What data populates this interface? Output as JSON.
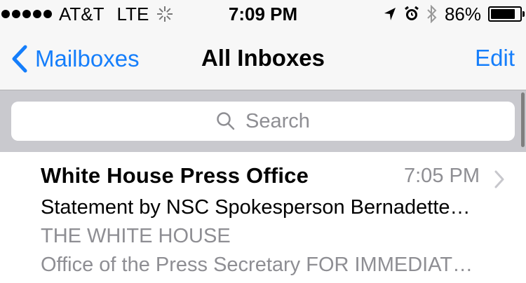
{
  "status_bar": {
    "carrier": "AT&T",
    "network": "LTE",
    "time": "7:09 PM",
    "battery_percent": "86%",
    "battery_level": 0.86,
    "icons": [
      "signal-dots-icon",
      "activity-spinner-icon",
      "location-arrow-icon",
      "alarm-icon",
      "bluetooth-icon",
      "battery-icon"
    ]
  },
  "nav": {
    "back_label": "Mailboxes",
    "title": "All Inboxes",
    "edit_label": "Edit"
  },
  "search": {
    "placeholder": "Search"
  },
  "messages": [
    {
      "sender": "White House Press Office",
      "time": "7:05 PM",
      "subject": "Statement by NSC Spokesperson Bernadette…",
      "preview_line1": "THE WHITE HOUSE",
      "preview_line2": "Office of the Press Secretary FOR IMMEDIAT…"
    }
  ],
  "colors": {
    "accent": "#157efb",
    "secondary_text": "#8e8e93",
    "search_bar_bg": "#c9c9ce",
    "nav_bg": "#f7f7f7"
  }
}
